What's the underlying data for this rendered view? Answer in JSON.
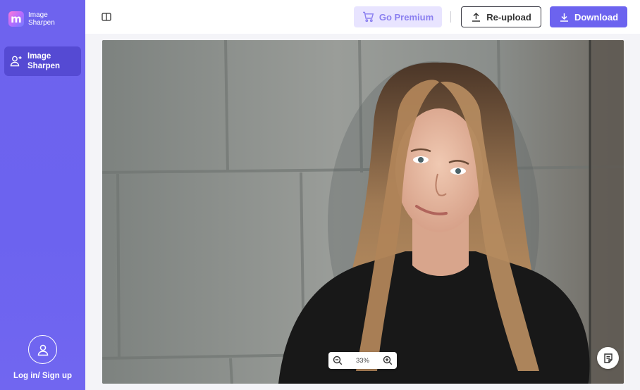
{
  "sidebar": {
    "logo": {
      "mark": "m",
      "text": "Image Sharpen",
      "icon": "app-logo-icon"
    },
    "nav": [
      {
        "label": "Image Sharpen",
        "icon": "user-sparkle-icon",
        "active": true
      }
    ],
    "login": {
      "label": "Log in/ Sign up",
      "icon": "user-avatar-icon"
    }
  },
  "toolbar": {
    "panel_toggle_icon": "split-panel-icon",
    "premium_label": "Go Premium",
    "premium_icon": "cart-icon",
    "reupload_label": "Re-upload",
    "reupload_icon": "upload-icon",
    "download_label": "Download",
    "download_icon": "download-icon"
  },
  "canvas": {
    "zoom": {
      "value": "33%",
      "zoom_out_icon": "zoom-out-icon",
      "zoom_in_icon": "zoom-in-icon"
    },
    "feedback_icon": "feedback-note-icon"
  },
  "colors": {
    "accent": "#6c63ef",
    "premium_bg": "#e8e4ff",
    "premium_text": "#8a7ff0"
  }
}
